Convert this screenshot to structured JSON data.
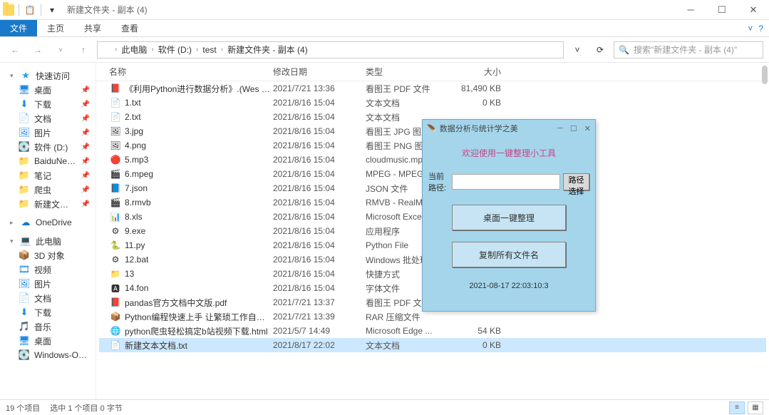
{
  "window": {
    "title": "新建文件夹 - 副本 (4)"
  },
  "ribbon": {
    "file": "文件",
    "home": "主页",
    "share": "共享",
    "view": "查看"
  },
  "breadcrumb": {
    "items": [
      "此电脑",
      "软件 (D:)",
      "test",
      "新建文件夹 - 副本 (4)"
    ]
  },
  "search": {
    "placeholder": "搜索\"新建文件夹 - 副本 (4)\""
  },
  "sidebar": {
    "quick_access": "快速访问",
    "quick_items": [
      {
        "label": "桌面",
        "icon": "🖥",
        "color": "ic-blue"
      },
      {
        "label": "下载",
        "icon": "⬇",
        "color": "ic-blue"
      },
      {
        "label": "文档",
        "icon": "📄",
        "color": "ic-blue"
      },
      {
        "label": "图片",
        "icon": "🖼",
        "color": "ic-blue"
      },
      {
        "label": "软件 (D:)",
        "icon": "💽",
        "color": "ic-disk"
      },
      {
        "label": "BaiduNetdiskDo",
        "icon": "📁",
        "color": "ic-folder"
      },
      {
        "label": "笔记",
        "icon": "📁",
        "color": "ic-folder"
      },
      {
        "label": "爬虫",
        "icon": "📁",
        "color": "ic-folder"
      },
      {
        "label": "新建文件夹 - 副",
        "icon": "📁",
        "color": "ic-folder"
      }
    ],
    "onedrive": "OneDrive",
    "this_pc": "此电脑",
    "pc_items": [
      {
        "label": "3D 对象",
        "icon": "📦"
      },
      {
        "label": "视频",
        "icon": "🎞"
      },
      {
        "label": "图片",
        "icon": "🖼"
      },
      {
        "label": "文档",
        "icon": "📄"
      },
      {
        "label": "下载",
        "icon": "⬇"
      },
      {
        "label": "音乐",
        "icon": "🎵"
      },
      {
        "label": "桌面",
        "icon": "🖥"
      },
      {
        "label": "Windows-OS (C",
        "icon": "💽"
      }
    ]
  },
  "columns": {
    "name": "名称",
    "date": "修改日期",
    "type": "类型",
    "size": "大小"
  },
  "files": [
    {
      "icon": "📕",
      "name": "《利用Python进行数据分析》.(Wes Mc...",
      "date": "2021/7/21 13:36",
      "type": "看图王 PDF 文件",
      "size": "81,490 KB"
    },
    {
      "icon": "📄",
      "name": "1.txt",
      "date": "2021/8/16 15:04",
      "type": "文本文档",
      "size": "0 KB"
    },
    {
      "icon": "📄",
      "name": "2.txt",
      "date": "2021/8/16 15:04",
      "type": "文本文档",
      "size": ""
    },
    {
      "icon": "🖼",
      "name": "3.jpg",
      "date": "2021/8/16 15:04",
      "type": "看图王 JPG 图片",
      "size": ""
    },
    {
      "icon": "🖼",
      "name": "4.png",
      "date": "2021/8/16 15:04",
      "type": "看图王 PNG 图片",
      "size": ""
    },
    {
      "icon": "🔴",
      "name": "5.mp3",
      "date": "2021/8/16 15:04",
      "type": "cloudmusic.mp",
      "size": ""
    },
    {
      "icon": "🎬",
      "name": "6.mpeg",
      "date": "2021/8/16 15:04",
      "type": "MPEG - MPEG",
      "size": ""
    },
    {
      "icon": "📘",
      "name": "7.json",
      "date": "2021/8/16 15:04",
      "type": "JSON 文件",
      "size": ""
    },
    {
      "icon": "🎬",
      "name": "8.rmvb",
      "date": "2021/8/16 15:04",
      "type": "RMVB - RealMe",
      "size": ""
    },
    {
      "icon": "📊",
      "name": "8.xls",
      "date": "2021/8/16 15:04",
      "type": "Microsoft Excel",
      "size": ""
    },
    {
      "icon": "⚙",
      "name": "9.exe",
      "date": "2021/8/16 15:04",
      "type": "应用程序",
      "size": ""
    },
    {
      "icon": "🐍",
      "name": "11.py",
      "date": "2021/8/16 15:04",
      "type": "Python File",
      "size": ""
    },
    {
      "icon": "⚙",
      "name": "12.bat",
      "date": "2021/8/16 15:04",
      "type": "Windows 批处理",
      "size": ""
    },
    {
      "icon": "📁",
      "name": "13",
      "date": "2021/8/16 15:04",
      "type": "快捷方式",
      "size": ""
    },
    {
      "icon": "🅰",
      "name": "14.fon",
      "date": "2021/8/16 15:04",
      "type": "字体文件",
      "size": ""
    },
    {
      "icon": "📕",
      "name": "pandas官方文档中文版.pdf",
      "date": "2021/7/21 13:37",
      "type": "看图王 PDF 文件",
      "size": ""
    },
    {
      "icon": "📦",
      "name": "Python编程快速上手 让繁琐工作自动化...",
      "date": "2021/7/21 13:39",
      "type": "RAR 压缩文件",
      "size": ""
    },
    {
      "icon": "🌐",
      "name": "python爬虫轻松搞定b站视频下载.html",
      "date": "2021/5/7 14:49",
      "type": "Microsoft Edge ...",
      "size": "54 KB"
    },
    {
      "icon": "📄",
      "name": "新建文本文档.txt",
      "date": "2021/8/17 22:02",
      "type": "文本文档",
      "size": "0 KB",
      "selected": true
    }
  ],
  "popup": {
    "title": "数据分析与统计学之美",
    "welcome": "欢迎使用一键整理小工具",
    "path_label": "当前路径:",
    "path_value": "",
    "path_btn": "路径选择",
    "btn1": "桌面一键整理",
    "btn2": "复制所有文件名",
    "timestamp": "2021-08-17 22:03:10:3"
  },
  "status": {
    "count": "19 个项目",
    "selected": "选中 1 个项目 0 字节"
  }
}
